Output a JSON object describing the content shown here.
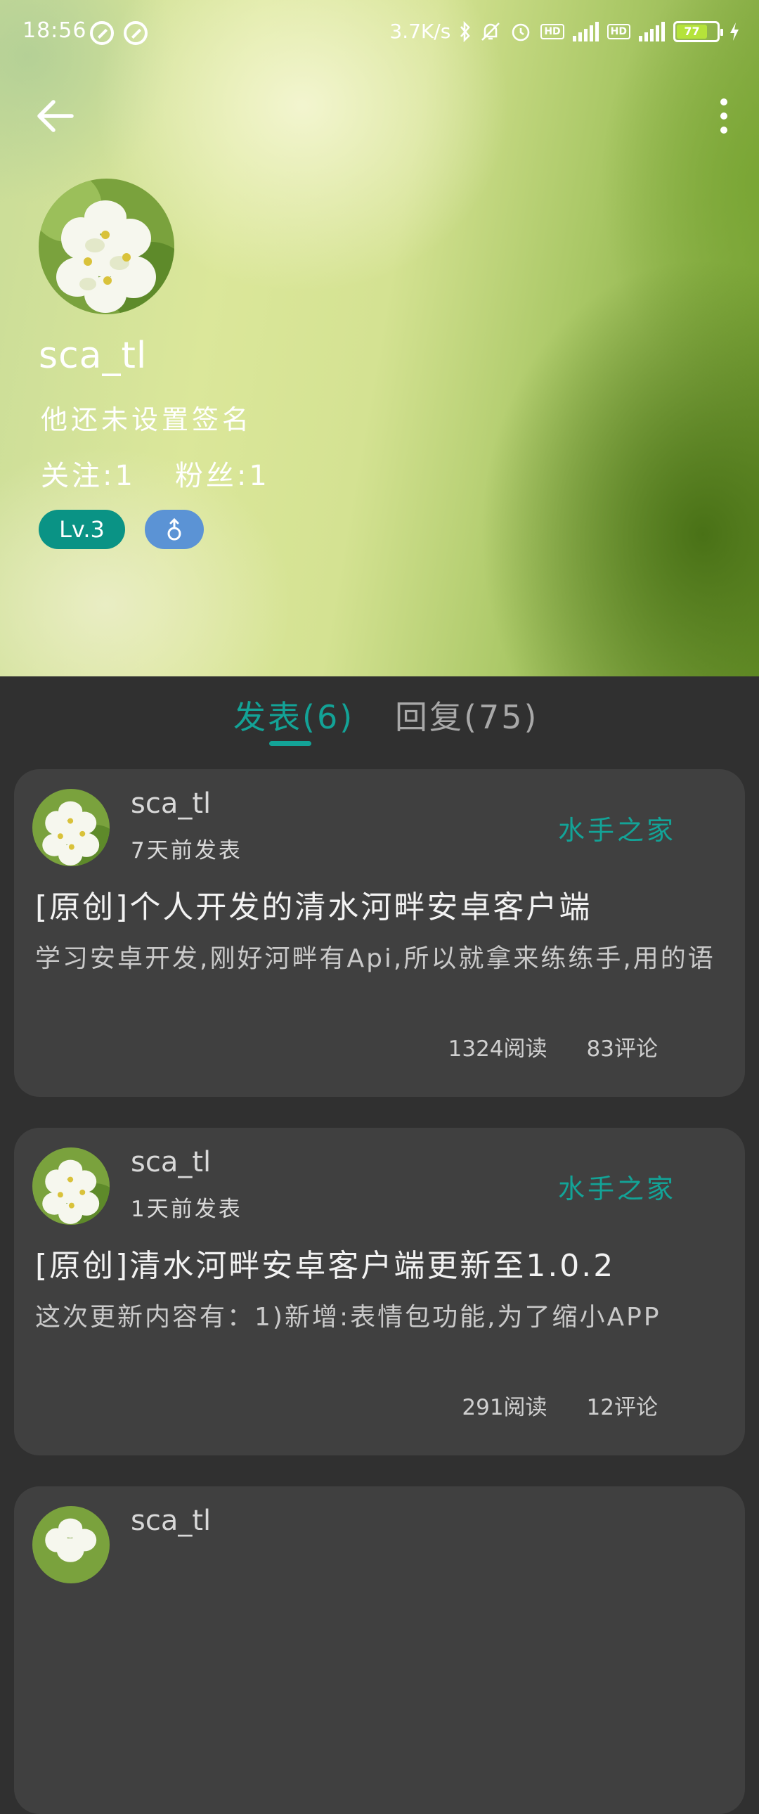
{
  "status_bar": {
    "time": "18:56",
    "speed": "3.7K/s",
    "battery": "77"
  },
  "profile": {
    "username": "sca_tl",
    "signature": "他还未设置签名",
    "following": "关注:1",
    "followers": "粉丝:1",
    "level": "Lv.3"
  },
  "tabs": [
    {
      "label": "发表(6)",
      "active": true
    },
    {
      "label": "回复(75)",
      "active": false
    }
  ],
  "posts": [
    {
      "author": "sca_tl",
      "time": "7天前发表",
      "forum": "水手之家",
      "title": "[原创]个人开发的清水河畔安卓客户端",
      "excerpt": "学习安卓开发,刚好河畔有Api,所以就拿来练练手,用的语",
      "reads": "1324阅读",
      "comments": "83评论"
    },
    {
      "author": "sca_tl",
      "time": "1天前发表",
      "forum": "水手之家",
      "title": "[原创]清水河畔安卓客户端更新至1.0.2",
      "excerpt": "这次更新内容有：1)新增:表情包功能,为了缩小APP",
      "reads": "291阅读",
      "comments": "12评论"
    },
    {
      "author": "sca_tl",
      "time": "",
      "forum": "",
      "title": "",
      "excerpt": "",
      "reads": "",
      "comments": ""
    }
  ],
  "colors": {
    "accent": "#13a397",
    "card_bg": "#404040",
    "page_bg": "#303030",
    "gender_badge": "#5b93d5"
  }
}
